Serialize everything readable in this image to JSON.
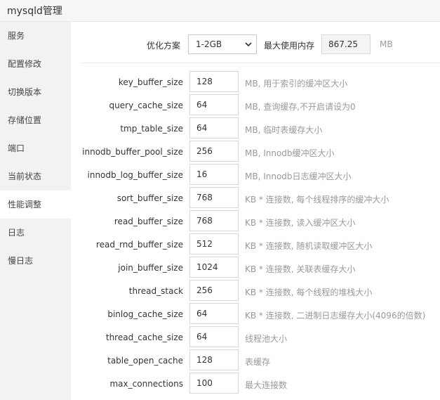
{
  "window": {
    "title": "mysqld管理"
  },
  "sidebar": {
    "items": [
      {
        "label": "服务",
        "active": false
      },
      {
        "label": "配置修改",
        "active": false
      },
      {
        "label": "切换版本",
        "active": false
      },
      {
        "label": "存储位置",
        "active": false
      },
      {
        "label": "端口",
        "active": false
      },
      {
        "label": "当前状态",
        "active": false
      },
      {
        "label": "性能调整",
        "active": true
      },
      {
        "label": "日志",
        "active": false
      },
      {
        "label": "慢日志",
        "active": false
      }
    ]
  },
  "optimize": {
    "plan_label": "优化方案",
    "plan_value": "1-2GB",
    "max_mem_label": "最大使用内存",
    "max_mem_value": "867.25",
    "max_mem_unit": "MB"
  },
  "params": [
    {
      "name": "key_buffer_size",
      "value": "128",
      "desc": "MB, 用于索引的缓冲区大小"
    },
    {
      "name": "query_cache_size",
      "value": "64",
      "desc": "MB, 查询缓存,不开启请设为0"
    },
    {
      "name": "tmp_table_size",
      "value": "64",
      "desc": "MB, 临时表缓存大小"
    },
    {
      "name": "innodb_buffer_pool_size",
      "value": "256",
      "desc": "MB, Innodb缓冲区大小"
    },
    {
      "name": "innodb_log_buffer_size",
      "value": "16",
      "desc": "MB, Innodb日志缓冲区大小"
    },
    {
      "name": "sort_buffer_size",
      "value": "768",
      "desc": "KB * 连接数, 每个线程排序的缓冲大小"
    },
    {
      "name": "read_buffer_size",
      "value": "768",
      "desc": "KB * 连接数, 读入缓冲区大小"
    },
    {
      "name": "read_rnd_buffer_size",
      "value": "512",
      "desc": "KB * 连接数, 随机读取缓冲区大小"
    },
    {
      "name": "join_buffer_size",
      "value": "1024",
      "desc": "KB * 连接数, 关联表缓存大小"
    },
    {
      "name": "thread_stack",
      "value": "256",
      "desc": "KB * 连接数, 每个线程的堆栈大小"
    },
    {
      "name": "binlog_cache_size",
      "value": "64",
      "desc": "KB * 连接数, 二进制日志缓存大小(4096的倍数)"
    },
    {
      "name": "thread_cache_size",
      "value": "64",
      "desc": "线程池大小"
    },
    {
      "name": "table_open_cache",
      "value": "128",
      "desc": "表缓存"
    },
    {
      "name": "max_connections",
      "value": "100",
      "desc": "最大连接数"
    }
  ]
}
